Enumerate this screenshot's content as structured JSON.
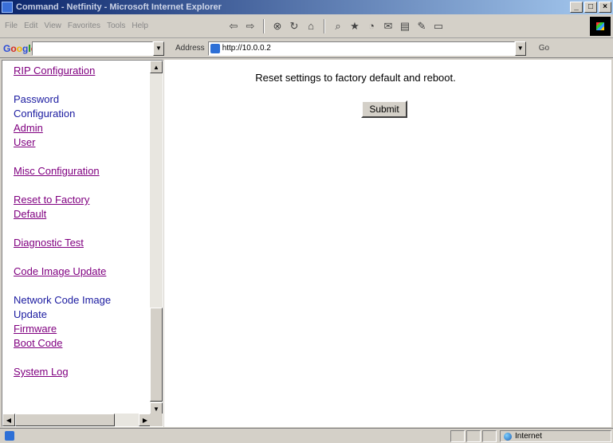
{
  "window": {
    "title": "Command - Netfinity - Microsoft Internet Explorer",
    "controls": [
      "_",
      "□",
      "×"
    ]
  },
  "menu": [
    "File",
    "Edit",
    "View",
    "Favorites",
    "Tools",
    "Help"
  ],
  "toolbar": {
    "icons": [
      "back-icon",
      "forward-icon",
      "stop-icon",
      "refresh-icon",
      "home-icon",
      "search-icon",
      "favorites-icon",
      "history-icon",
      "mail-icon",
      "print-icon",
      "edit-icon",
      "discuss-icon"
    ]
  },
  "google_bar": {
    "logo": "Google",
    "search_value": ""
  },
  "address_bar": {
    "label": "Address",
    "url": "http://10.0.0.2",
    "go_label": "Go"
  },
  "sidebar": {
    "items": [
      {
        "label": "RIP Configuration",
        "link": true
      },
      {
        "label": "Password",
        "link": false
      },
      {
        "label": "Configuration",
        "link": false
      },
      {
        "label": "Admin",
        "link": true
      },
      {
        "label": "User",
        "link": true
      },
      {
        "label": "Misc Configuration",
        "link": true
      },
      {
        "label": "Reset to Factory",
        "link": true
      },
      {
        "label": "Default",
        "link": true
      },
      {
        "label": "Diagnostic Test",
        "link": true
      },
      {
        "label": "Code Image Update",
        "link": true
      },
      {
        "label": "Network Code Image",
        "link": false
      },
      {
        "label": "Update",
        "link": false
      },
      {
        "label": "Firmware",
        "link": true
      },
      {
        "label": "Boot Code",
        "link": true
      },
      {
        "label": "System Log",
        "link": true
      }
    ]
  },
  "main": {
    "message": "Reset settings to factory default and reboot.",
    "submit_label": "Submit"
  },
  "statusbar": {
    "zone_label": "Internet"
  }
}
